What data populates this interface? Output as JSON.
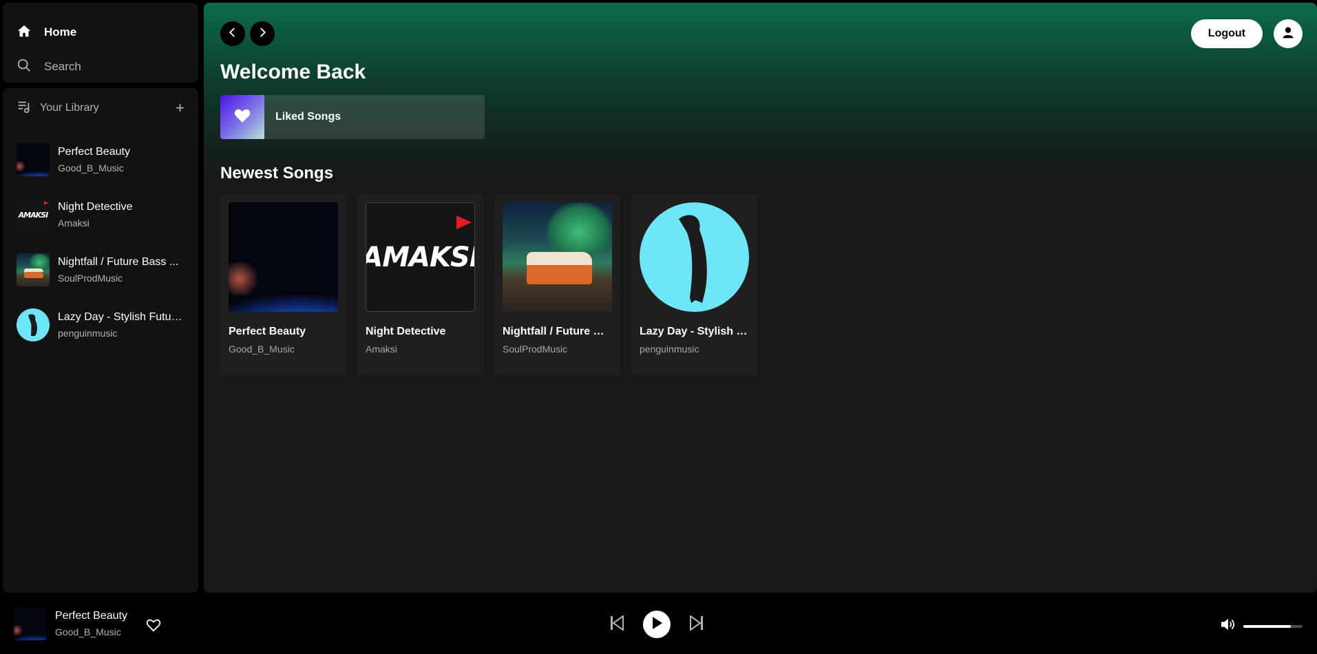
{
  "nav": {
    "home_label": "Home",
    "search_label": "Search"
  },
  "library": {
    "title": "Your Library",
    "add_symbol": "+",
    "items": [
      {
        "title": "Perfect Beauty",
        "artist": "Good_B_Music",
        "art": "earth"
      },
      {
        "title": "Night Detective",
        "artist": "Amaksi",
        "art": "amaksi"
      },
      {
        "title": "Nightfall / Future Bass ...",
        "artist": "SoulProdMusic",
        "art": "van"
      },
      {
        "title": "Lazy Day - Stylish Futuri...",
        "artist": "penguinmusic",
        "art": "penguin"
      }
    ]
  },
  "header": {
    "logout_label": "Logout",
    "welcome": "Welcome Back",
    "liked_label": "Liked Songs"
  },
  "newest": {
    "title": "Newest Songs",
    "cards": [
      {
        "title": "Perfect Beauty",
        "artist": "Good_B_Music",
        "art": "earth"
      },
      {
        "title": "Night Detective",
        "artist": "Amaksi",
        "art": "amaksi"
      },
      {
        "title": "Nightfall / Future Ba...",
        "artist": "SoulProdMusic",
        "art": "van"
      },
      {
        "title": "Lazy Day - Stylish F...",
        "artist": "penguinmusic",
        "art": "penguin"
      }
    ]
  },
  "player": {
    "title": "Perfect Beauty",
    "artist": "Good_B_Music",
    "volume": 0.8
  },
  "logo_text": {
    "amaksi": "AMAKSI"
  },
  "colors": {
    "accent_green": "#0b6b4c",
    "background": "#121212"
  }
}
